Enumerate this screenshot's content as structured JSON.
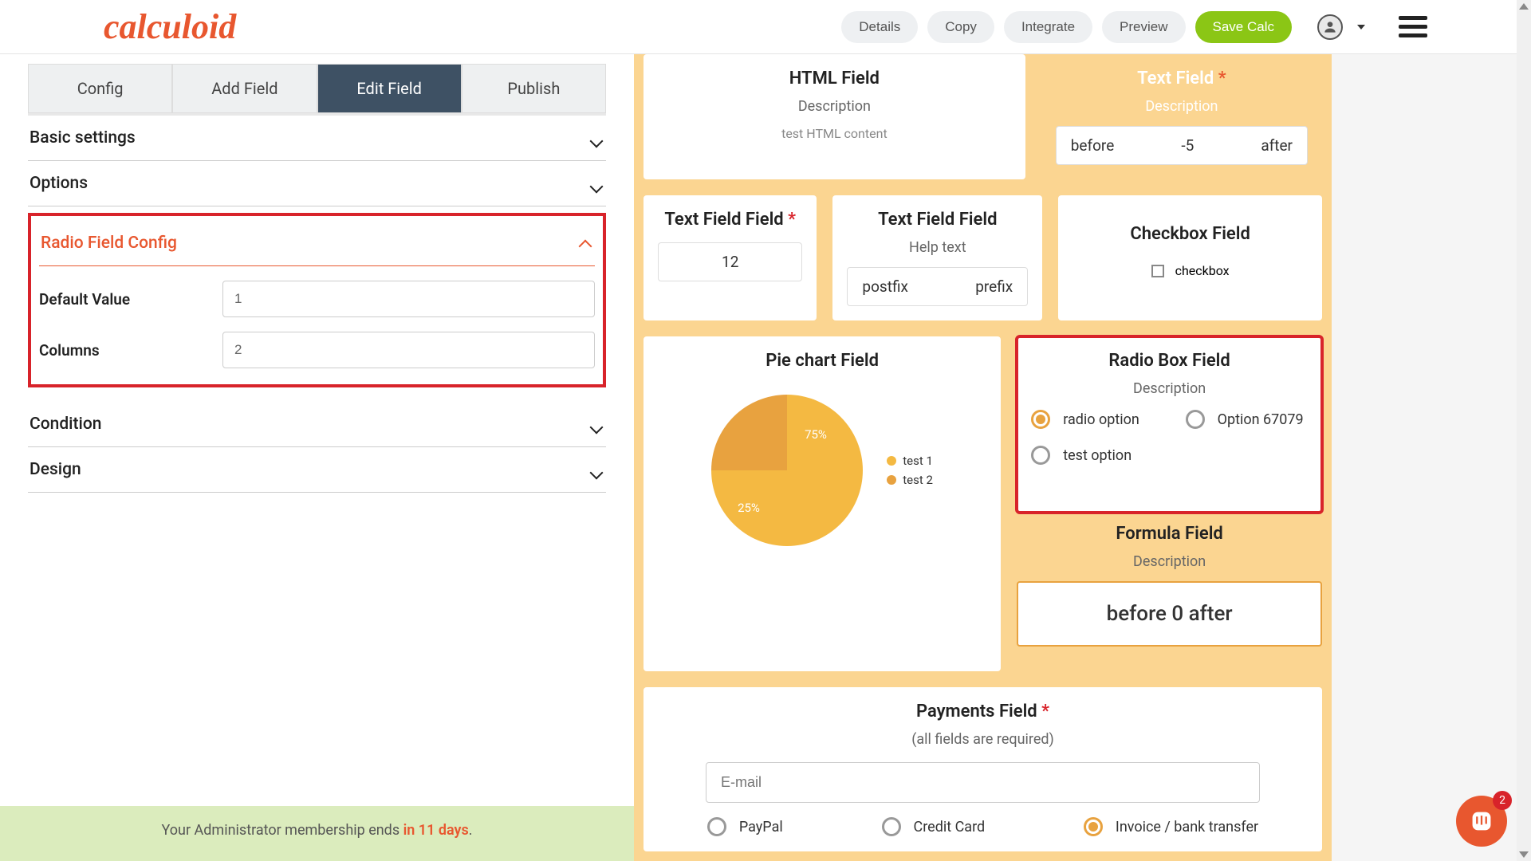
{
  "header": {
    "logo": "calculoid",
    "buttons": {
      "details": "Details",
      "copy": "Copy",
      "integrate": "Integrate",
      "preview": "Preview",
      "save": "Save Calc"
    }
  },
  "sidebar": {
    "tabs": {
      "config": "Config",
      "add": "Add Field",
      "edit": "Edit Field",
      "publish": "Publish"
    },
    "sections": {
      "basic": "Basic settings",
      "options": "Options",
      "radio_config": "Radio Field Config",
      "condition": "Condition",
      "design": "Design"
    },
    "radio_config": {
      "default_label": "Default Value",
      "default_value": "1",
      "columns_label": "Columns",
      "columns_value": "2"
    }
  },
  "footer": {
    "text_prefix": "Your Administrator membership ends ",
    "text_days": "in 11 days",
    "text_suffix": "."
  },
  "preview": {
    "html_field": {
      "title": "HTML Field",
      "desc": "Description",
      "content": "test HTML content"
    },
    "text_field_top": {
      "title": "Text Field ",
      "desc": "Description",
      "before": "before",
      "value": "-5",
      "after": "after"
    },
    "text_field_field": {
      "title": "Text Field Field ",
      "value": "12"
    },
    "text_field_help": {
      "title": "Text Field Field",
      "help": "Help text",
      "postfix": "postfix",
      "prefix": "prefix"
    },
    "checkbox_field": {
      "title": "Checkbox Field",
      "label": "checkbox"
    },
    "pie": {
      "title": "Pie chart Field",
      "slice1": "25%",
      "slice2": "75%",
      "legend1": "test 1",
      "legend2": "test 2"
    },
    "radio": {
      "title": "Radio Box Field",
      "desc": "Description",
      "opt1": "radio option",
      "opt2": "Option 67079",
      "opt3": "test option"
    },
    "formula": {
      "title": "Formula Field",
      "desc": "Description",
      "value": "before 0 after"
    },
    "payments": {
      "title": "Payments Field ",
      "sub": "(all fields are required)",
      "email_placeholder": "E-mail",
      "paypal": "PayPal",
      "credit": "Credit Card",
      "invoice": "Invoice / bank transfer"
    }
  },
  "chat_badge": "2",
  "chart_data": {
    "type": "pie",
    "title": "Pie chart Field",
    "series": [
      {
        "name": "test 1",
        "value": 25
      },
      {
        "name": "test 2",
        "value": 75
      }
    ]
  }
}
